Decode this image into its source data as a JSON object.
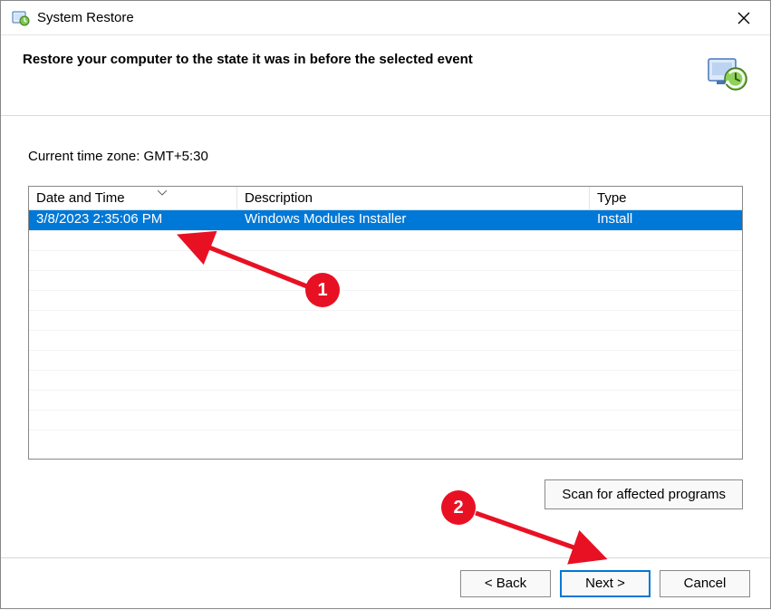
{
  "titlebar": {
    "title": "System Restore"
  },
  "header": {
    "heading": "Restore your computer to the state it was in before the selected event"
  },
  "content": {
    "timezone_label": "Current time zone: GMT+5:30",
    "scan_button": "Scan for affected programs"
  },
  "table": {
    "headers": {
      "datetime": "Date and Time",
      "description": "Description",
      "type": "Type"
    },
    "rows": [
      {
        "datetime": "3/8/2023 2:35:06 PM",
        "description": "Windows Modules Installer",
        "type": "Install"
      }
    ]
  },
  "footer": {
    "back": "< Back",
    "next": "Next >",
    "cancel": "Cancel"
  },
  "annotations": {
    "badge1": "1",
    "badge2": "2"
  }
}
